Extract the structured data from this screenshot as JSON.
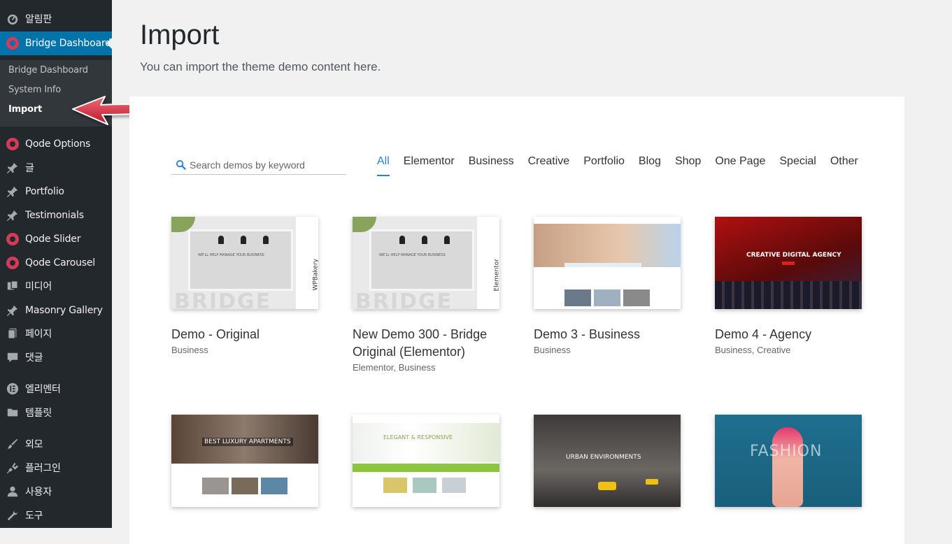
{
  "sidebar": {
    "items": [
      {
        "label": "알림판",
        "icon": "dashboard-icon"
      },
      {
        "label": "Bridge Dashboard",
        "icon": "bridge-icon"
      },
      {
        "label": "Qode Options",
        "icon": "qode-icon"
      },
      {
        "label": "글",
        "icon": "pin-icon"
      },
      {
        "label": "Portfolio",
        "icon": "pin-icon"
      },
      {
        "label": "Testimonials",
        "icon": "pin-icon"
      },
      {
        "label": "Qode Slider",
        "icon": "qode-icon"
      },
      {
        "label": "Qode Carousel",
        "icon": "qode-icon"
      },
      {
        "label": "미디어",
        "icon": "media-icon"
      },
      {
        "label": "Masonry Gallery",
        "icon": "pin-icon"
      },
      {
        "label": "페이지",
        "icon": "page-icon"
      },
      {
        "label": "댓글",
        "icon": "comment-icon"
      },
      {
        "label": "엘리멘터",
        "icon": "elementor-icon"
      },
      {
        "label": "템플릿",
        "icon": "folder-icon"
      },
      {
        "label": "외모",
        "icon": "brush-icon"
      },
      {
        "label": "플러그인",
        "icon": "plugin-icon"
      },
      {
        "label": "사용자",
        "icon": "user-icon"
      },
      {
        "label": "도구",
        "icon": "wrench-icon"
      }
    ],
    "submenu": [
      "Bridge Dashboard",
      "System Info",
      "Import"
    ]
  },
  "header": {
    "title": "Import",
    "subtitle": "You can import the theme demo content here."
  },
  "search": {
    "placeholder": "Search demos by keyword"
  },
  "filters": [
    "All",
    "Elementor",
    "Business",
    "Creative",
    "Portfolio",
    "Blog",
    "Shop",
    "One Page",
    "Special",
    "Other"
  ],
  "demos": [
    {
      "title": "Demo - Original",
      "categories": "Business"
    },
    {
      "title": "New Demo 300 - Bridge Original (Elementor)",
      "categories": "Elementor,  Business"
    },
    {
      "title": "Demo 3 - Business",
      "categories": "Business"
    },
    {
      "title": "Demo 4 - Agency",
      "categories": "Business,  Creative"
    }
  ],
  "thumbs": {
    "original_tagline": "WE'LL HELP MANAGE YOUR BUSINESS",
    "original_word": "BRIDGE",
    "original_side": "WPBakery",
    "elementor_side": "Elementor",
    "agency_title": "CREATIVE DIGITAL AGENCY",
    "estate_title": "BEST LUXURY APARTMENTS",
    "health_title": "ELEGANT & RESPONSIVE",
    "urban_title": "URBAN ENVIRONMENTS",
    "fashion_title": "FASHION"
  },
  "colors": {
    "sidebar_bg": "#23282d",
    "active_bg": "#0073aa",
    "accent": "#2b7fd4",
    "arrow": "#d9384a"
  }
}
